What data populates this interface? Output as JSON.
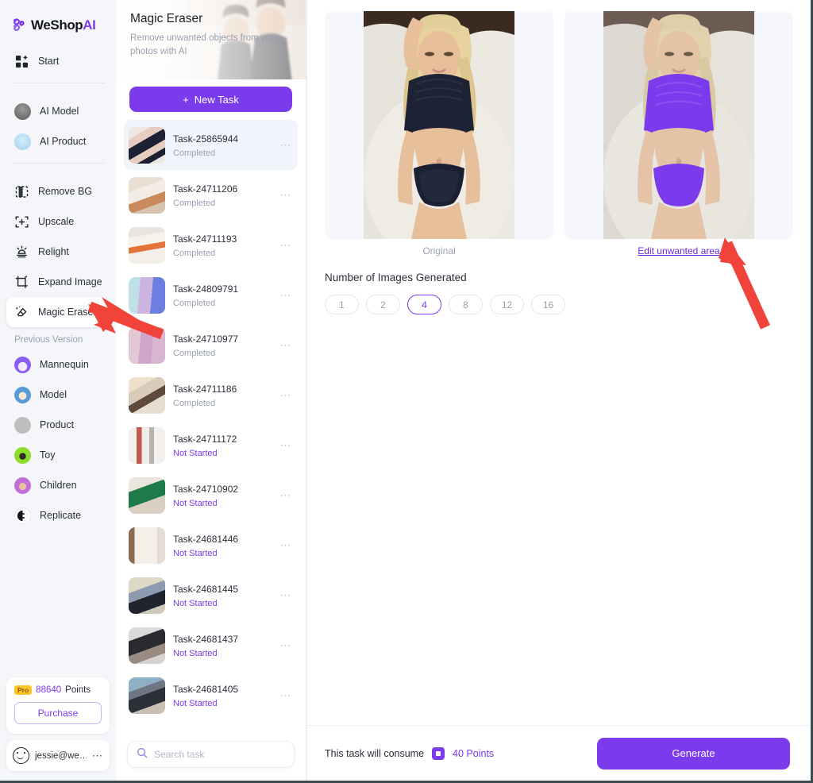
{
  "brand": {
    "name_part1": "WeShop",
    "name_part2": "AI",
    "logo_icon": "weshop-logo-icon"
  },
  "sidebar": {
    "primary": [
      {
        "label": "Start",
        "icon": "grid-start-icon"
      }
    ],
    "ai_tools": [
      {
        "label": "AI Model",
        "icon": "ai-model-avatar-icon"
      },
      {
        "label": "AI Product",
        "icon": "ai-product-avatar-icon"
      }
    ],
    "editing_tools": [
      {
        "label": "Remove BG",
        "icon": "remove-bg-icon",
        "active": false
      },
      {
        "label": "Upscale",
        "icon": "upscale-icon",
        "active": false
      },
      {
        "label": "Relight",
        "icon": "relight-icon",
        "active": false
      },
      {
        "label": "Expand Image",
        "icon": "expand-image-icon",
        "active": false
      },
      {
        "label": "Magic Eraser",
        "icon": "magic-eraser-icon",
        "active": true
      }
    ],
    "previous_version_label": "Previous Version",
    "previous_version": [
      {
        "label": "Mannequin",
        "icon": "mannequin-avatar-icon"
      },
      {
        "label": "Model",
        "icon": "model-avatar-icon"
      },
      {
        "label": "Product",
        "icon": "product-avatar-icon"
      },
      {
        "label": "Toy",
        "icon": "toy-avatar-icon"
      },
      {
        "label": "Children",
        "icon": "children-avatar-icon"
      },
      {
        "label": "Replicate",
        "icon": "replicate-icon"
      }
    ],
    "account": {
      "pro_badge": "Pro",
      "points_value": "88640",
      "points_label": "Points",
      "purchase_label": "Purchase",
      "user_email": "jessie@we…",
      "user_menu_icon": "ellipsis-icon"
    }
  },
  "task_panel": {
    "hero_title": "Magic Eraser",
    "hero_subtitle": "Remove unwanted objects from your photos with AI",
    "new_task_label": "New Task",
    "new_task_icon": "plus-icon",
    "tasks": [
      {
        "name": "Task-25865944",
        "status": "Completed",
        "selected": true
      },
      {
        "name": "Task-24711206",
        "status": "Completed",
        "selected": false
      },
      {
        "name": "Task-24711193",
        "status": "Completed",
        "selected": false
      },
      {
        "name": "Task-24809791",
        "status": "Completed",
        "selected": false
      },
      {
        "name": "Task-24710977",
        "status": "Completed",
        "selected": false
      },
      {
        "name": "Task-24711186",
        "status": "Completed",
        "selected": false
      },
      {
        "name": "Task-24711172",
        "status": "Not Started",
        "selected": false
      },
      {
        "name": "Task-24710902",
        "status": "Not Started",
        "selected": false
      },
      {
        "name": "Task-24681446",
        "status": "Not Started",
        "selected": false
      },
      {
        "name": "Task-24681445",
        "status": "Not Started",
        "selected": false
      },
      {
        "name": "Task-24681437",
        "status": "Not Started",
        "selected": false
      },
      {
        "name": "Task-24681405",
        "status": "Not Started",
        "selected": false
      }
    ],
    "search_placeholder": "Search task",
    "search_value": "",
    "search_icon": "search-icon"
  },
  "main": {
    "original_caption": "Original",
    "edit_link_label": "Edit unwanted area",
    "images_section_title": "Number of Images Generated",
    "image_counts": [
      "1",
      "2",
      "4",
      "8",
      "12",
      "16"
    ],
    "selected_count": "4",
    "footer": {
      "consume_text": "This task will consume",
      "points_icon": "points-chip-icon",
      "points_cost": "40 Points",
      "generate_label": "Generate"
    }
  },
  "colors": {
    "accent": "#7c3aed",
    "accent_link": "#6d28d9",
    "sidebar_bg": "#f5f6fa",
    "preview_bg": "#f6f7fd",
    "status_completed": "#9aa0b0",
    "status_not_started": "#7c3aed",
    "pro_badge_bg": "#ffc62b",
    "annotation_arrow": "#f0443a",
    "mask_overlay": "#7c3aed"
  },
  "annotations": [
    {
      "name": "arrow-to-magic-eraser",
      "color": "#f0443a"
    },
    {
      "name": "arrow-to-edit-unwanted-area",
      "color": "#f0443a"
    }
  ]
}
